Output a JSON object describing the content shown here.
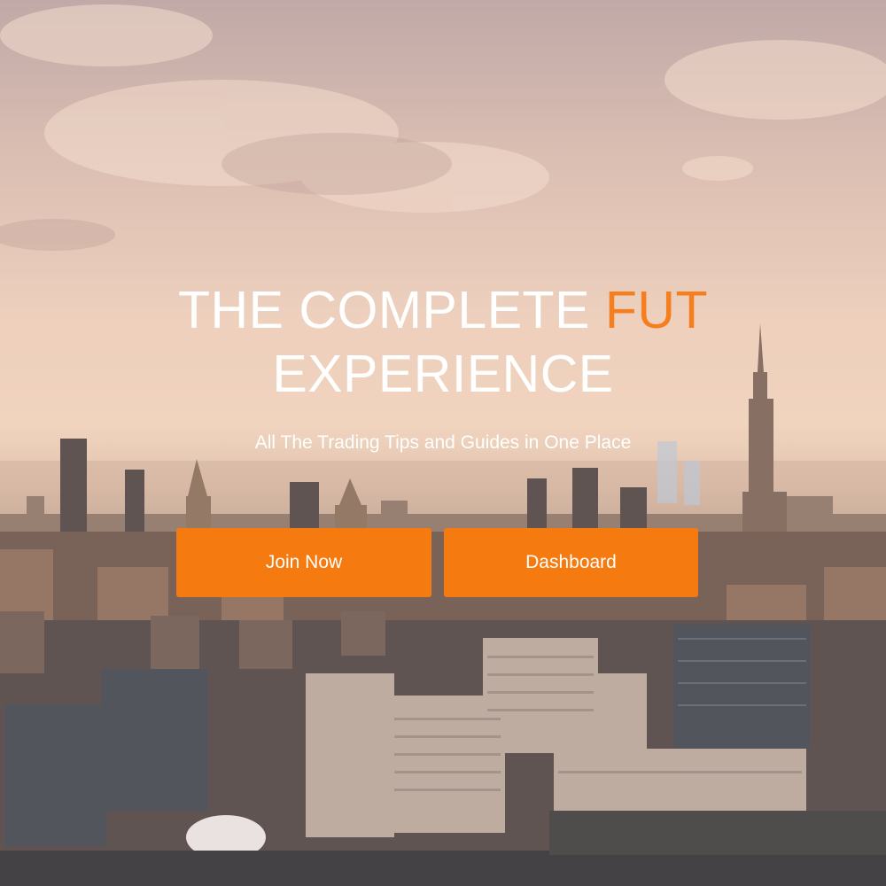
{
  "hero": {
    "headline_part1": "THE COMPLETE ",
    "headline_accent": "FUT",
    "headline_part2": "EXPERIENCE",
    "subtitle": "All The Trading Tips and Guides in One Place",
    "accent_color": "#f57f1e"
  },
  "buttons": {
    "join_label": "Join Now",
    "dashboard_label": "Dashboard",
    "color": "#f57a10"
  }
}
